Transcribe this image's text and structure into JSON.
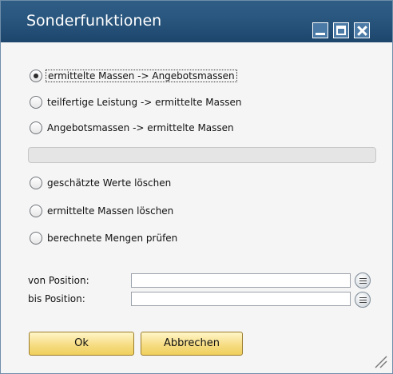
{
  "window": {
    "title": "Sonderfunktionen"
  },
  "options_top": [
    {
      "label": "ermittelte Massen -> Angebotsmassen",
      "selected": true
    },
    {
      "label": "teilfertige Leistung -> ermittelte Massen",
      "selected": false
    },
    {
      "label": "Angebotsmassen -> ermittelte Massen",
      "selected": false
    }
  ],
  "options_bottom": [
    {
      "label": "geschätzte Werte löschen",
      "selected": false
    },
    {
      "label": "ermittelte Massen löschen",
      "selected": false
    },
    {
      "label": "berechnete Mengen prüfen",
      "selected": false
    }
  ],
  "fields": {
    "from_label": "von Position:",
    "from_value": "",
    "to_label": "bis Position:",
    "to_value": ""
  },
  "buttons": {
    "ok": "Ok",
    "cancel": "Abbrechen"
  }
}
